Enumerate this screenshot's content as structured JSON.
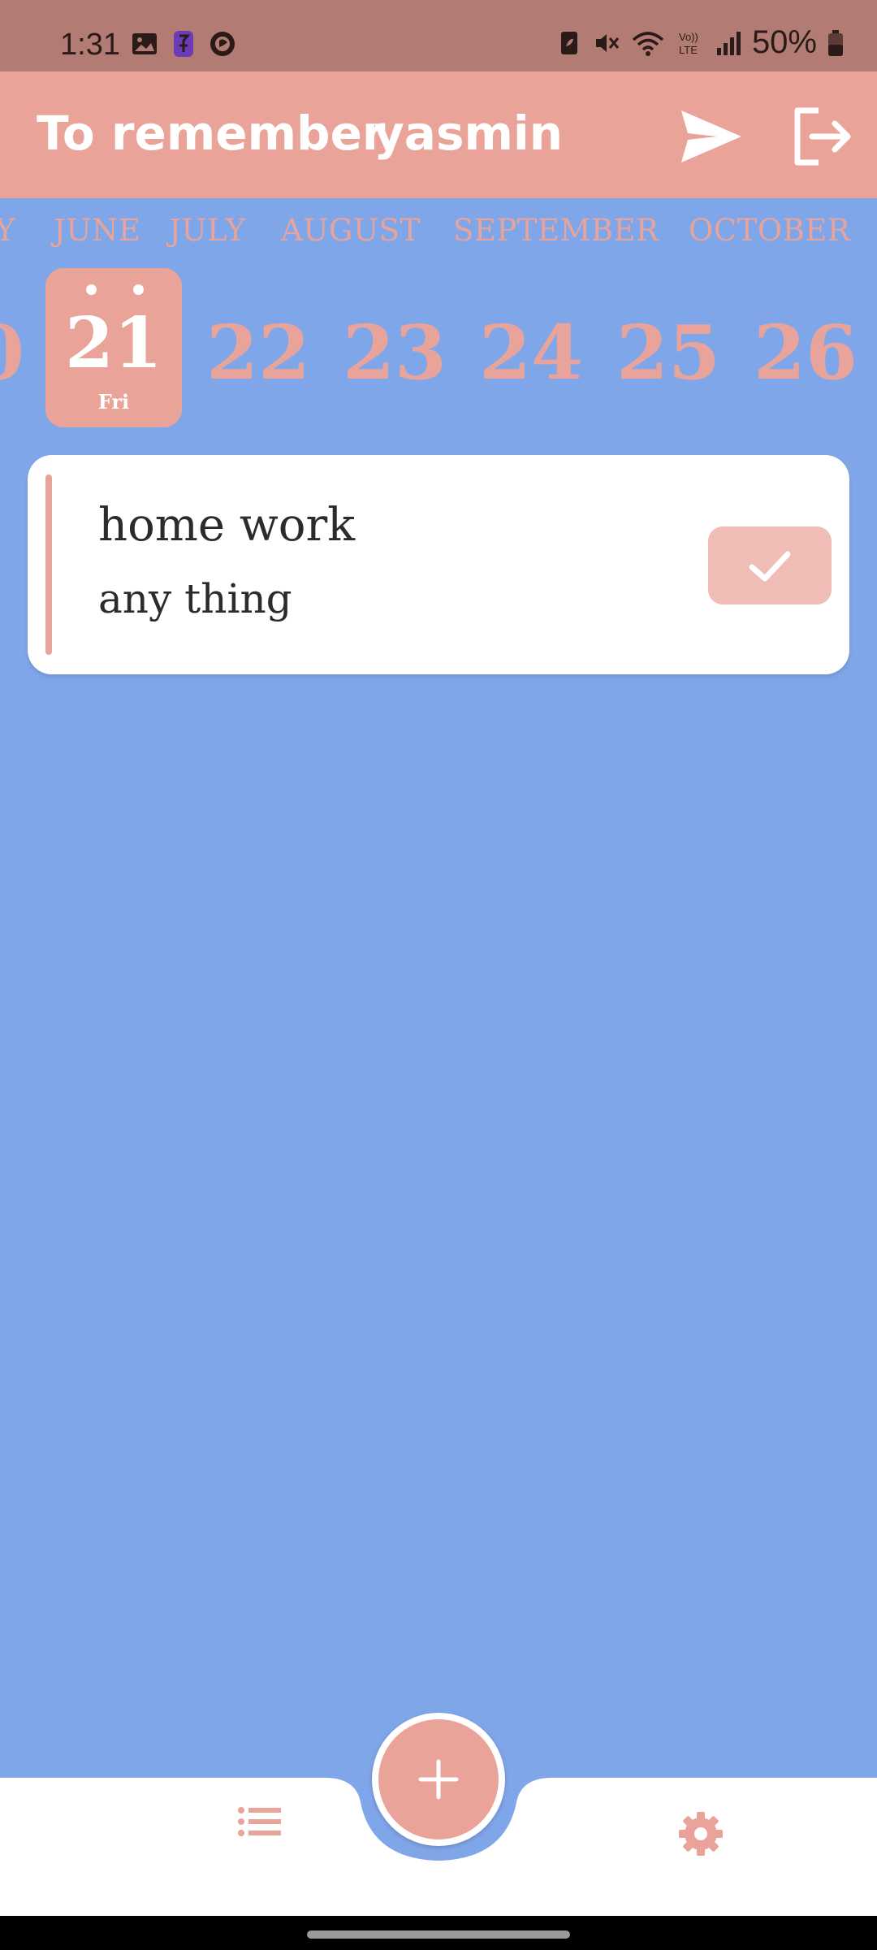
{
  "status_bar": {
    "time": "1:31",
    "battery": "50%",
    "left_icons": [
      "gallery-icon",
      "app-notification-icon",
      "phone-app-icon"
    ],
    "right_icons": [
      "battery-saver-icon",
      "mute-icon",
      "wifi-icon",
      "volte-icon",
      "signal-icon",
      "battery-icon"
    ]
  },
  "app_bar": {
    "title": "To remember",
    "user": "yasmin",
    "actions": [
      "send-icon",
      "logout-icon"
    ]
  },
  "months": {
    "partial": "Y",
    "items": [
      "JUNE",
      "JULY",
      "AUGUST",
      "SEPTEMBER",
      "OCTOBER"
    ]
  },
  "dates": {
    "partial": "0",
    "selected": {
      "day": "21",
      "weekday": "Fri"
    },
    "items": [
      "22",
      "23",
      "24",
      "25",
      "26"
    ]
  },
  "tasks": [
    {
      "title": "home work",
      "description": "any thing",
      "completed": false
    }
  ],
  "colors": {
    "status_bar": "#b27c74",
    "accent": "#eaa398",
    "background": "#80a6ea",
    "card": "#ffffff",
    "check_button": "#f0bcb6"
  },
  "bottom_nav": {
    "items": [
      "list-icon",
      "add-icon",
      "settings-icon"
    ]
  }
}
